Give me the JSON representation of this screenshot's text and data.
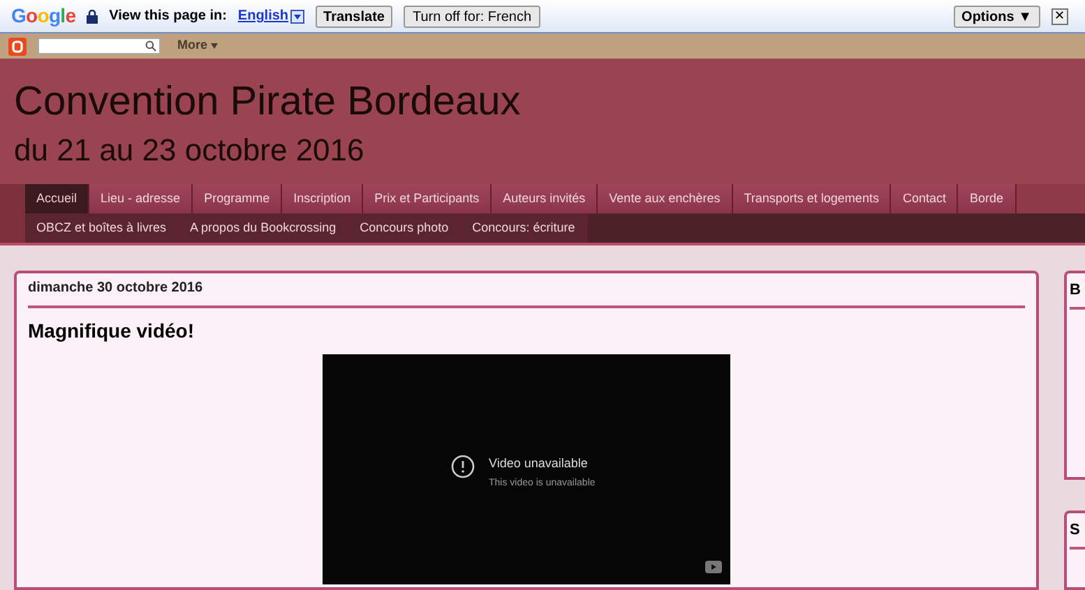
{
  "translate_bar": {
    "logo": "Google",
    "prompt": "View this page in:",
    "language": "English",
    "translate_button": "Translate",
    "turn_off_button": "Turn off for: French",
    "options_button": "Options ▼",
    "close": "✕"
  },
  "blogger_bar": {
    "more": "More"
  },
  "header": {
    "title": "Convention Pirate Bordeaux",
    "subtitle": "du 21 au 23 octobre 2016"
  },
  "nav_rows": [
    [
      {
        "label": "Accueil",
        "selected": true
      },
      {
        "label": "Lieu - adresse",
        "selected": false
      },
      {
        "label": "Programme",
        "selected": false
      },
      {
        "label": "Inscription",
        "selected": false
      },
      {
        "label": "Prix et Participants",
        "selected": false
      },
      {
        "label": "Auteurs invités",
        "selected": false
      },
      {
        "label": "Vente aux enchères",
        "selected": false
      },
      {
        "label": "Transports et logements",
        "selected": false
      },
      {
        "label": "Contact",
        "selected": false
      },
      {
        "label": "Borde",
        "selected": false
      }
    ],
    [
      {
        "label": "OBCZ et boîtes à livres",
        "selected": false
      },
      {
        "label": "A propos du Bookcrossing",
        "selected": false
      },
      {
        "label": "Concours photo",
        "selected": false
      },
      {
        "label": "Concours: écriture",
        "selected": false
      }
    ]
  ],
  "post": {
    "date": "dimanche 30 octobre 2016",
    "title": "Magnifique vidéo!",
    "video": {
      "message": "Video unavailable",
      "detail": "This video is unavailable"
    }
  },
  "sidebar": [
    {
      "title": "B"
    },
    {
      "title": "S"
    }
  ]
}
